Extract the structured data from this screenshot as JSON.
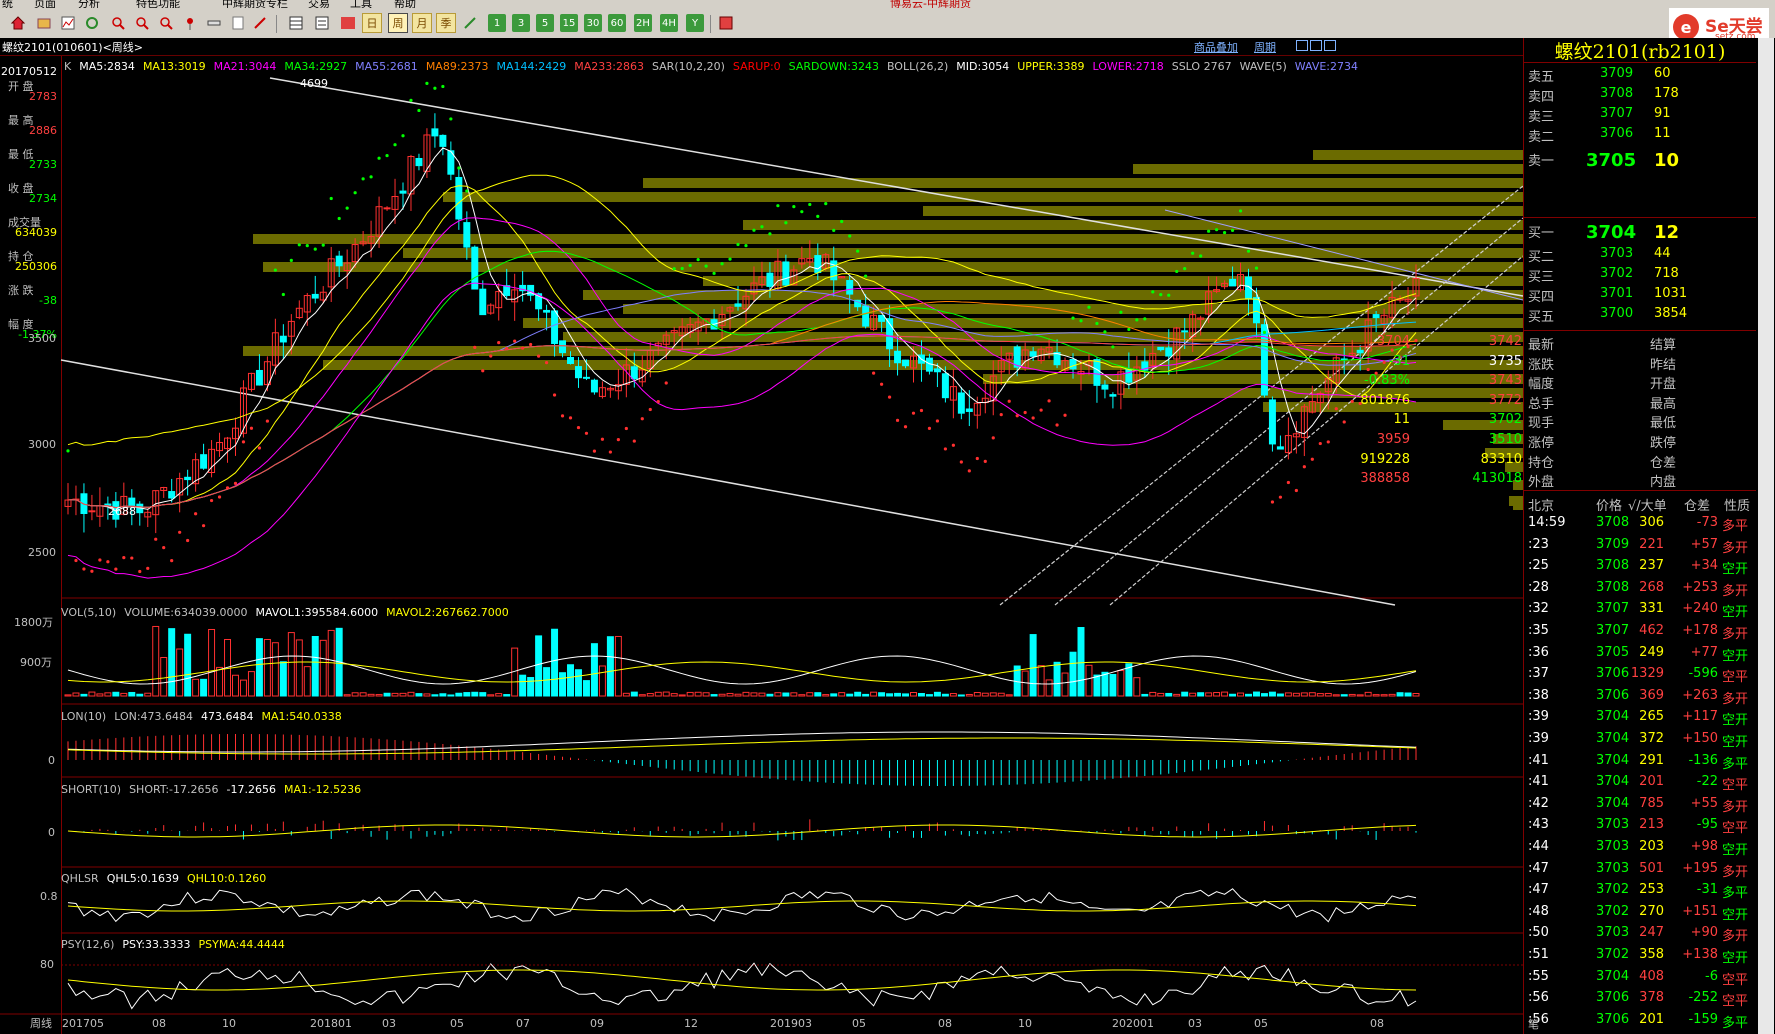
{
  "menu": {
    "items": [
      "统",
      "页面",
      "分析",
      "特色功能",
      "中辉期货专栏",
      "交易",
      "工具",
      "帮助"
    ],
    "center_title": "博易云-中辉期货"
  },
  "toolbar": {
    "periods": [
      "日",
      "周",
      "月",
      "季",
      "1",
      "3",
      "5",
      "15",
      "30",
      "60",
      "2H",
      "4H",
      "Y"
    ],
    "active_period": "周"
  },
  "logo": {
    "text": "Se天尝",
    "sub": "setz.com",
    "mark": "e"
  },
  "title_bar": {
    "left": "螺纹2101(010601)<周线>",
    "link1": "商品叠加",
    "link2": "周期"
  },
  "main_chart": {
    "indicator_line": [
      {
        "text": "K",
        "color": "#c0c0c0"
      },
      {
        "text": "MA5:2834",
        "color": "#ffffff"
      },
      {
        "text": "MA13:3019",
        "color": "#ffff00"
      },
      {
        "text": "MA21:3044",
        "color": "#ff00ff"
      },
      {
        "text": "MA34:2927",
        "color": "#00ff00"
      },
      {
        "text": "MA55:2681",
        "color": "#8080ff"
      },
      {
        "text": "MA89:2373",
        "color": "#ff8000"
      },
      {
        "text": "MA144:2429",
        "color": "#00bfff"
      },
      {
        "text": "MA233:2863",
        "color": "#ff4040"
      },
      {
        "text": "SAR(10,2,20)",
        "color": "#c0c0c0"
      },
      {
        "text": "SARUP:0",
        "color": "#ff0000"
      },
      {
        "text": "SARDOWN:3243",
        "color": "#00ff00"
      },
      {
        "text": "BOLL(26,2)",
        "color": "#c0c0c0"
      },
      {
        "text": "MID:3054",
        "color": "#ffffff"
      },
      {
        "text": "UPPER:3389",
        "color": "#ffff00"
      },
      {
        "text": "LOWER:2718",
        "color": "#ff00ff"
      },
      {
        "text": "SSLO 2767",
        "color": "#c0c0c0"
      },
      {
        "text": "WAVE(5)",
        "color": "#c0c0c0"
      },
      {
        "text": "WAVE:2734",
        "color": "#8080ff"
      }
    ],
    "y_ticks": [
      "3500",
      "3000",
      "2500"
    ],
    "high_label": "4699",
    "low_label": "2688"
  },
  "info_box": {
    "date": "20170512",
    "items": [
      {
        "label": "开  盘",
        "value": "2783",
        "color": "#ff4040"
      },
      {
        "label": "最  高",
        "value": "2886",
        "color": "#ff4040"
      },
      {
        "label": "最  低",
        "value": "2733",
        "color": "#00ff00"
      },
      {
        "label": "收  盘",
        "value": "2734",
        "color": "#00ff00"
      },
      {
        "label": "成交量",
        "value": "634039",
        "color": "#ffff00"
      },
      {
        "label": "持  仓",
        "value": "250306",
        "color": "#ffff00"
      },
      {
        "label": "涨  跌",
        "value": "-38",
        "color": "#00ff00"
      },
      {
        "label": "幅  度",
        "value": "-1.37%",
        "color": "#00ff00"
      }
    ]
  },
  "sub_panels": [
    {
      "title_parts": [
        {
          "text": "VOL(5,10)",
          "color": "#c0c0c0"
        },
        {
          "text": "VOLUME:634039.0000",
          "color": "#c0c0c0"
        },
        {
          "text": "MAVOL1:395584.6000",
          "color": "#ffffff"
        },
        {
          "text": "MAVOL2:267662.7000",
          "color": "#ffff00"
        }
      ],
      "ticks": [
        "1800万",
        "900万"
      ]
    },
    {
      "title_parts": [
        {
          "text": "LON(10)",
          "color": "#c0c0c0"
        },
        {
          "text": "LON:473.6484",
          "color": "#c0c0c0"
        },
        {
          "text": "473.6484",
          "color": "#ffffff"
        },
        {
          "text": "MA1:540.0338",
          "color": "#ffff00"
        }
      ],
      "ticks": [
        "0"
      ]
    },
    {
      "title_parts": [
        {
          "text": "SHORT(10)",
          "color": "#c0c0c0"
        },
        {
          "text": "SHORT:-17.2656",
          "color": "#c0c0c0"
        },
        {
          "text": "-17.2656",
          "color": "#ffffff"
        },
        {
          "text": "MA1:-12.5236",
          "color": "#ffff00"
        }
      ],
      "ticks": [
        "0"
      ]
    },
    {
      "title_parts": [
        {
          "text": "QHLSR",
          "color": "#c0c0c0"
        },
        {
          "text": "QHL5:0.1639",
          "color": "#ffffff"
        },
        {
          "text": "QHL10:0.1260",
          "color": "#ffff00"
        }
      ],
      "ticks": [
        "0.8"
      ]
    },
    {
      "title_parts": [
        {
          "text": "PSY(12,6)",
          "color": "#c0c0c0"
        },
        {
          "text": "PSY:33.3333",
          "color": "#ffffff"
        },
        {
          "text": "PSYMA:44.4444",
          "color": "#ffff00"
        }
      ],
      "ticks": [
        "80"
      ]
    }
  ],
  "x_axis": {
    "label": "周线",
    "ticks": [
      "201705",
      "08",
      "10",
      "201801",
      "03",
      "05",
      "07",
      "09",
      "12",
      "201903",
      "05",
      "08",
      "10",
      "202001",
      "03",
      "05",
      "08"
    ]
  },
  "quote": {
    "title": "螺纹2101(rb2101)",
    "asks": [
      {
        "label": "卖五",
        "price": "3709",
        "vol": "60"
      },
      {
        "label": "卖四",
        "price": "3708",
        "vol": "178"
      },
      {
        "label": "卖三",
        "price": "3707",
        "vol": "91"
      },
      {
        "label": "卖二",
        "price": "3706",
        "vol": "11"
      },
      {
        "label": "卖一",
        "price": "3705",
        "vol": "10"
      }
    ],
    "bids": [
      {
        "label": "买一",
        "price": "3704",
        "vol": "12"
      },
      {
        "label": "买二",
        "price": "3703",
        "vol": "44"
      },
      {
        "label": "买三",
        "price": "3702",
        "vol": "718"
      },
      {
        "label": "买四",
        "price": "3701",
        "vol": "1031"
      },
      {
        "label": "买五",
        "price": "3700",
        "vol": "3854"
      }
    ],
    "stats": [
      {
        "l1": "最新",
        "v1": "3704",
        "c1": "#ff4040",
        "l2": "结算",
        "v2": "3742",
        "c2": "#ff4040"
      },
      {
        "l1": "涨跌",
        "v1": "-31",
        "c1": "#00ff00",
        "l2": "昨结",
        "v2": "3735",
        "c2": "#ffffff"
      },
      {
        "l1": "幅度",
        "v1": "-0.83%",
        "c1": "#00ff00",
        "l2": "开盘",
        "v2": "3743",
        "c2": "#ff4040"
      },
      {
        "l1": "总手",
        "v1": "801876",
        "c1": "#ffff00",
        "l2": "最高",
        "v2": "3772",
        "c2": "#ff4040"
      },
      {
        "l1": "现手",
        "v1": "11",
        "c1": "#ffff00",
        "l2": "最低",
        "v2": "3702",
        "c2": "#00ff00"
      },
      {
        "l1": "涨停",
        "v1": "3959",
        "c1": "#ff4040",
        "l2": "跌停",
        "v2": "3510",
        "c2": "#00ff00"
      },
      {
        "l1": "持仓",
        "v1": "919228",
        "c1": "#ffff00",
        "l2": "仓差",
        "v2": "83310",
        "c2": "#ffff00"
      },
      {
        "l1": "外盘",
        "v1": "388858",
        "c1": "#ff4040",
        "l2": "内盘",
        "v2": "413018",
        "c2": "#00ff00"
      }
    ],
    "trade_header": {
      "time": "北京",
      "price": "价格",
      "vol": "√/大单",
      "oi": "仓差",
      "nature": "性质"
    },
    "trades": [
      {
        "t": "14:59",
        "p": "3708",
        "v": "306",
        "d": "-73",
        "n": "多平",
        "vc": "#ffff00",
        "dc": "#ff4040",
        "nc": "#ff4040"
      },
      {
        "t": ":23",
        "p": "3709",
        "v": "221",
        "d": "+57",
        "n": "多开",
        "vc": "#ff4040",
        "dc": "#ff4040",
        "nc": "#ff4040"
      },
      {
        "t": ":25",
        "p": "3708",
        "v": "237",
        "d": "+34",
        "n": "空开",
        "vc": "#ffff00",
        "dc": "#ff4040",
        "nc": "#00ff00"
      },
      {
        "t": ":28",
        "p": "3708",
        "v": "268",
        "d": "+253",
        "n": "多开",
        "vc": "#ff4040",
        "dc": "#ff4040",
        "nc": "#ff4040"
      },
      {
        "t": ":32",
        "p": "3707",
        "v": "331",
        "d": "+240",
        "n": "空开",
        "vc": "#ffff00",
        "dc": "#ff4040",
        "nc": "#00ff00"
      },
      {
        "t": ":35",
        "p": "3707",
        "v": "462",
        "d": "+178",
        "n": "多开",
        "vc": "#ff4040",
        "dc": "#ff4040",
        "nc": "#ff4040"
      },
      {
        "t": ":36",
        "p": "3705",
        "v": "249",
        "d": "+77",
        "n": "空开",
        "vc": "#ffff00",
        "dc": "#ff4040",
        "nc": "#00ff00"
      },
      {
        "t": ":37",
        "p": "3706",
        "v": "1329",
        "d": "-596",
        "n": "空平",
        "vc": "#ff4040",
        "dc": "#00ff00",
        "nc": "#ff4040"
      },
      {
        "t": ":38",
        "p": "3706",
        "v": "369",
        "d": "+263",
        "n": "多开",
        "vc": "#ff4040",
        "dc": "#ff4040",
        "nc": "#ff4040"
      },
      {
        "t": ":39",
        "p": "3704",
        "v": "265",
        "d": "+117",
        "n": "空开",
        "vc": "#ffff00",
        "dc": "#ff4040",
        "nc": "#00ff00"
      },
      {
        "t": ":39",
        "p": "3704",
        "v": "372",
        "d": "+150",
        "n": "空开",
        "vc": "#ffff00",
        "dc": "#ff4040",
        "nc": "#00ff00"
      },
      {
        "t": ":41",
        "p": "3704",
        "v": "291",
        "d": "-136",
        "n": "多平",
        "vc": "#ffff00",
        "dc": "#00ff00",
        "nc": "#00ff00"
      },
      {
        "t": ":41",
        "p": "3704",
        "v": "201",
        "d": "-22",
        "n": "空平",
        "vc": "#ff4040",
        "dc": "#00ff00",
        "nc": "#ff4040"
      },
      {
        "t": ":42",
        "p": "3704",
        "v": "785",
        "d": "+55",
        "n": "多开",
        "vc": "#ff4040",
        "dc": "#ff4040",
        "nc": "#ff4040"
      },
      {
        "t": ":43",
        "p": "3703",
        "v": "213",
        "d": "-95",
        "n": "空平",
        "vc": "#ff4040",
        "dc": "#00ff00",
        "nc": "#ff4040"
      },
      {
        "t": ":44",
        "p": "3703",
        "v": "203",
        "d": "+98",
        "n": "空开",
        "vc": "#ffff00",
        "dc": "#ff4040",
        "nc": "#00ff00"
      },
      {
        "t": ":47",
        "p": "3703",
        "v": "501",
        "d": "+195",
        "n": "多开",
        "vc": "#ff4040",
        "dc": "#ff4040",
        "nc": "#ff4040"
      },
      {
        "t": ":47",
        "p": "3702",
        "v": "253",
        "d": "-31",
        "n": "多平",
        "vc": "#ffff00",
        "dc": "#00ff00",
        "nc": "#00ff00"
      },
      {
        "t": ":48",
        "p": "3702",
        "v": "270",
        "d": "+151",
        "n": "空开",
        "vc": "#ffff00",
        "dc": "#ff4040",
        "nc": "#00ff00"
      },
      {
        "t": ":50",
        "p": "3703",
        "v": "247",
        "d": "+90",
        "n": "多开",
        "vc": "#ff4040",
        "dc": "#ff4040",
        "nc": "#ff4040"
      },
      {
        "t": ":51",
        "p": "3702",
        "v": "358",
        "d": "+138",
        "n": "空开",
        "vc": "#ffff00",
        "dc": "#ff4040",
        "nc": "#00ff00"
      },
      {
        "t": ":55",
        "p": "3704",
        "v": "408",
        "d": "-6",
        "n": "空平",
        "vc": "#ff4040",
        "dc": "#00ff00",
        "nc": "#ff4040"
      },
      {
        "t": ":56",
        "p": "3706",
        "v": "378",
        "d": "-252",
        "n": "空平",
        "vc": "#ff4040",
        "dc": "#00ff00",
        "nc": "#ff4040"
      },
      {
        "t": ":56",
        "p": "3706",
        "v": "201",
        "d": "-159",
        "n": "多平",
        "vc": "#ffff00",
        "dc": "#00ff00",
        "nc": "#00ff00"
      }
    ],
    "footer": "笔"
  }
}
